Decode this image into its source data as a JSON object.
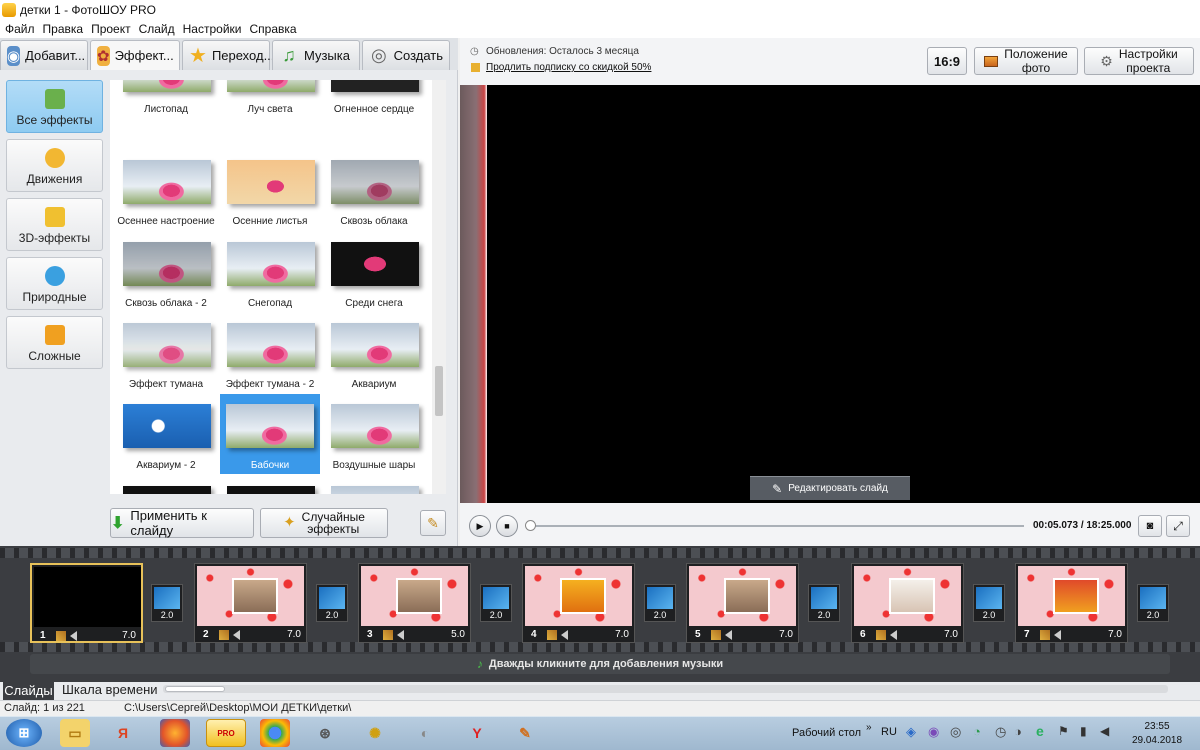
{
  "window": {
    "title": "детки 1 - ФотоШОУ PRO"
  },
  "menu": [
    "Файл",
    "Правка",
    "Проект",
    "Слайд",
    "Настройки",
    "Справка"
  ],
  "tabs": [
    {
      "label": "Добавит...",
      "icon": "camera-icon"
    },
    {
      "label": "Эффект...",
      "icon": "palette-icon"
    },
    {
      "label": "Переход...",
      "icon": "star-icon"
    },
    {
      "label": "Музыка",
      "icon": "music-note-icon"
    },
    {
      "label": "Создать",
      "icon": "disc-icon"
    }
  ],
  "categories": [
    {
      "label": "Все эффекты",
      "icon": "puzzle-icon",
      "active": true
    },
    {
      "label": "Движения",
      "icon": "move-arrows-icon",
      "active": false
    },
    {
      "label": "3D-эффекты",
      "icon": "cube-icon",
      "active": false
    },
    {
      "label": "Природные",
      "icon": "snowflake-icon",
      "active": false
    },
    {
      "label": "Сложные",
      "icon": "layers-icon",
      "active": false
    }
  ],
  "effects": [
    "Листопад",
    "Луч света",
    "Огненное сердце",
    "Осеннее настроение",
    "Осенние листья",
    "Сквозь облака",
    "Сквозь облака - 2",
    "Снегопад",
    "Среди снега",
    "Эффект тумана",
    "Эффект тумана - 2",
    "Аквариум",
    "Аквариум - 2",
    "Бабочки",
    "Воздушные шары"
  ],
  "selected_effect": "Бабочки",
  "buttons": {
    "apply": "Применить к слайду",
    "random_line1": "Случайные",
    "random_line2": "эффекты"
  },
  "header": {
    "updates": "Обновления: Осталось 3 месяца",
    "extend": "Продлить подписку со скидкой 50%",
    "aspect": "16:9",
    "photo_pos_line1": "Положение",
    "photo_pos_line2": "фото",
    "settings_line1": "Настройки",
    "settings_line2": "проекта"
  },
  "preview": {
    "edit_slide": "Редактировать слайд"
  },
  "player": {
    "timecode": "00:05.073 / 18:25.000"
  },
  "slides": [
    {
      "num": "1",
      "duration": "7.0"
    },
    {
      "num": "2",
      "duration": "7.0"
    },
    {
      "num": "3",
      "duration": "5.0"
    },
    {
      "num": "4",
      "duration": "7.0"
    },
    {
      "num": "5",
      "duration": "7.0"
    },
    {
      "num": "6",
      "duration": "7.0"
    },
    {
      "num": "7",
      "duration": "7.0"
    }
  ],
  "transitions": [
    "2.0",
    "2.0",
    "2.0",
    "2.0",
    "2.0",
    "2.0",
    "2.0"
  ],
  "music_hint": "Дважды кликните для добавления музыки",
  "bottom_tabs": {
    "slides": "Слайды",
    "timeline": "Шкала времени"
  },
  "status": {
    "slide": "Слайд: 1 из 221",
    "path": "C:\\Users\\Сергей\\Desktop\\МОИ ДЕТКИ\\детки\\"
  },
  "taskbar": {
    "desktop": "Рабочий стол",
    "lang": "RU",
    "time": "23:55",
    "date": "29.04.2018"
  }
}
